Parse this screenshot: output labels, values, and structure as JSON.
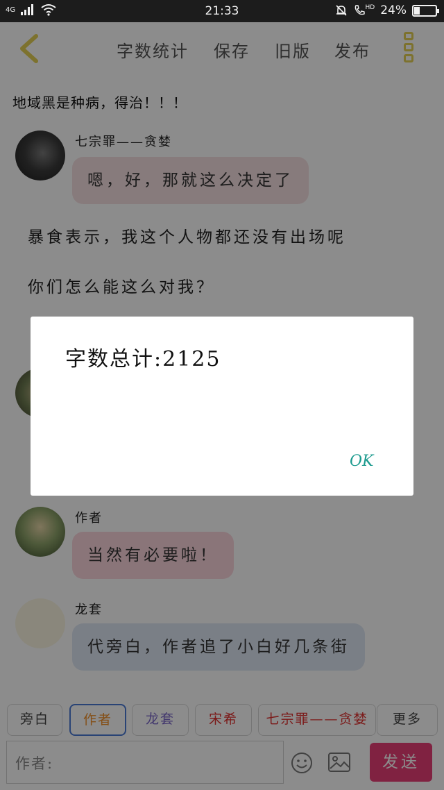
{
  "status_bar": {
    "network": "4G",
    "time": "21:33",
    "hd": "HD",
    "battery_text": "24%",
    "battery_level": 0.24
  },
  "toolbar": {
    "items": [
      "字数统计",
      "保存",
      "旧版",
      "发布"
    ]
  },
  "story": {
    "header": "地域黑是种病，得治！！！",
    "messages": [
      {
        "speaker": "七宗罪——贪婪",
        "text": "嗯，好，那就这么决定了"
      },
      {
        "narration": "暴食表示，我这个人物都还没有出场呢"
      },
      {
        "narration": "你们怎么能这么对我？"
      },
      {
        "speaker": "作者",
        "text": "当然有必要啦！"
      },
      {
        "speaker": "龙套",
        "text": "代旁白，作者追了小白好几条街"
      }
    ]
  },
  "roles": [
    {
      "label": "旁白",
      "color": "#444444"
    },
    {
      "label": "作者",
      "color": "#f0902a",
      "selected": true
    },
    {
      "label": "龙套",
      "color": "#7a66c8"
    },
    {
      "label": "宋希",
      "color": "#e0302f"
    },
    {
      "label": "七宗罪——贪婪",
      "color": "#e0302f"
    },
    {
      "label": "更多",
      "color": "#444444"
    }
  ],
  "input": {
    "value": "作者:"
  },
  "send_label": "发送",
  "dialog": {
    "message": "字数总计:2125",
    "ok_label": "OK"
  },
  "colors": {
    "accent_yellow": "#e3cf54",
    "send_pink": "#ea3f77",
    "ok_teal": "#1b9a8e",
    "selected_border": "#4b7bd6"
  }
}
